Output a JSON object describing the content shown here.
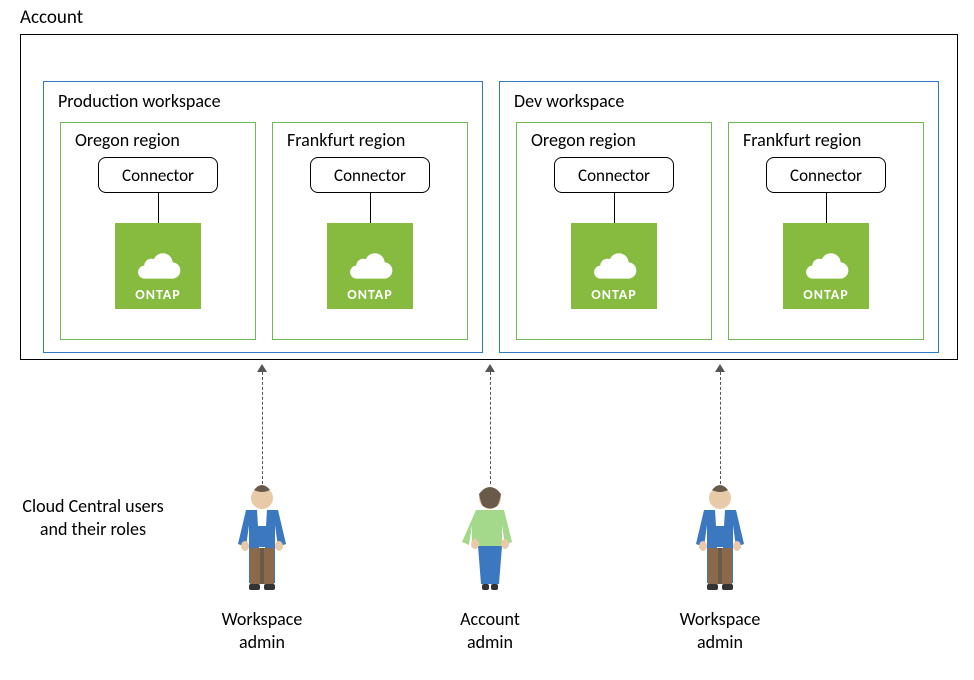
{
  "account": {
    "label": "Account"
  },
  "workspaces": [
    {
      "label": "Production workspace",
      "regions": [
        {
          "label": "Oregon region",
          "connector": "Connector",
          "product": "ONTAP"
        },
        {
          "label": "Frankfurt region",
          "connector": "Connector",
          "product": "ONTAP"
        }
      ]
    },
    {
      "label": "Dev workspace",
      "regions": [
        {
          "label": "Oregon region",
          "connector": "Connector",
          "product": "ONTAP"
        },
        {
          "label": "Frankfurt region",
          "connector": "Connector",
          "product": "ONTAP"
        }
      ]
    }
  ],
  "side_label": "Cloud Central users and their roles",
  "users": [
    {
      "role": "Workspace admin",
      "type": "workspace"
    },
    {
      "role": "Account admin",
      "type": "account"
    },
    {
      "role": "Workspace admin",
      "type": "workspace"
    }
  ],
  "colors": {
    "ontap_bg": "#86bb40",
    "workspace_border": "#2f78c4",
    "region_border": "#72b655",
    "person_blue": "#3c78c0",
    "person_green": "#a4d88a",
    "person_skin": "#e8c9a8",
    "person_pants": "#8a6a4a"
  }
}
